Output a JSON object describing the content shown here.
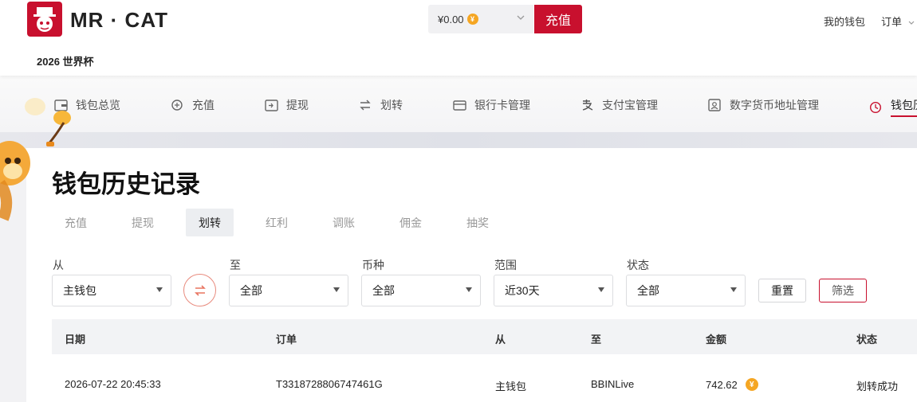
{
  "header": {
    "logo_text": "MR · CAT",
    "event_label": "2026 世界杯",
    "balance": "¥0.00",
    "coin_symbol": "¥",
    "recharge_label": "充值",
    "wallet_link": "我的钱包",
    "orders_link": "订单"
  },
  "nav": {
    "items": [
      {
        "label": "钱包总览",
        "icon": "wallet-icon"
      },
      {
        "label": "充值",
        "icon": "recharge-icon"
      },
      {
        "label": "提现",
        "icon": "withdraw-icon"
      },
      {
        "label": "划转",
        "icon": "transfer-icon"
      },
      {
        "label": "银行卡管理",
        "icon": "bank-card-icon"
      },
      {
        "label": "支付宝管理",
        "icon": "alipay-icon"
      },
      {
        "label": "数字货币地址管理",
        "icon": "crypto-address-icon"
      },
      {
        "label": "钱包历",
        "icon": "clock-icon"
      }
    ],
    "active_index": 7
  },
  "page": {
    "title": "钱包历史记录",
    "tabs": [
      "充值",
      "提现",
      "划转",
      "红利",
      "调账",
      "佣金",
      "抽奖"
    ],
    "active_tab": "划转"
  },
  "filters": {
    "from_label": "从",
    "from_value": "主钱包",
    "to_label": "至",
    "to_value": "全部",
    "currency_label": "币种",
    "currency_value": "全部",
    "range_label": "范围",
    "range_value": "近30天",
    "status_label": "状态",
    "status_value": "全部",
    "reset_label": "重置",
    "filter_label": "筛选"
  },
  "table": {
    "columns": [
      "日期",
      "订单",
      "从",
      "至",
      "金额",
      "状态"
    ],
    "rows": [
      {
        "date": "2026-07-22 20:45:33",
        "order": "T3318728806747461G",
        "from": "主钱包",
        "to": "BBINLive",
        "amount": "742.62",
        "status": "划转成功"
      }
    ]
  },
  "colors": {
    "brand_red": "#c8102e",
    "coin_gold": "#f5a623"
  }
}
